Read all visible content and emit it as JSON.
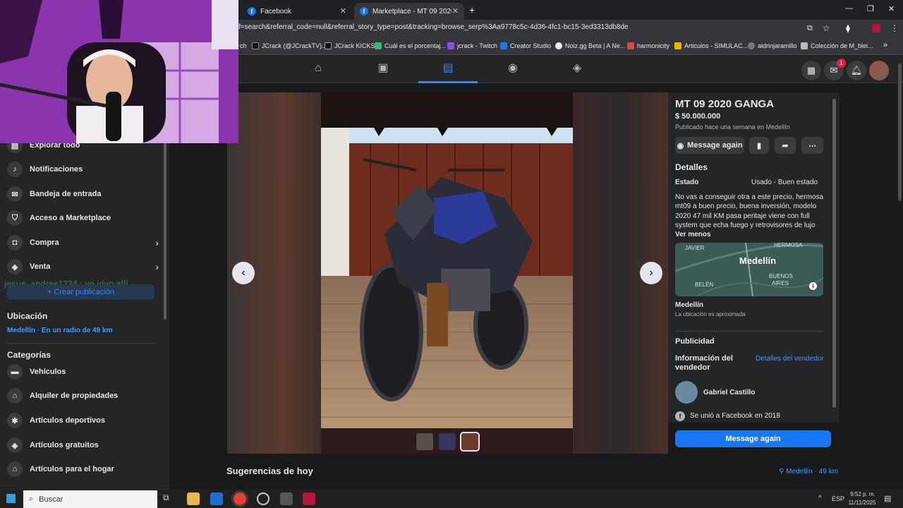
{
  "browser": {
    "tabs": [
      {
        "title": "Facebook",
        "icon": "facebook-icon"
      },
      {
        "title": "Marketplace - MT 09 2020 GAN",
        "icon": "facebook-icon"
      }
    ],
    "new_tab": "+",
    "url": "f=search&referral_code=null&referral_story_type=post&tracking=browse_serp%3Aa9778c5c-4d36-4fc1-bc15-3ed3313db8de",
    "bookmarks": [
      "ch",
      "JCrack (@JCrackTV)...",
      "JCrack KICKS",
      "Cuál es el porcentaj...",
      "jcrack - Twitch",
      "Creator Studio",
      "Noiz.gg Beta | A Ne...",
      "harmonicity",
      "Articulos - SIMULAC...",
      "aldrinjaramillo",
      "Colección de M_blei..."
    ],
    "more": "»"
  },
  "nav": {
    "notification_count": "1"
  },
  "sidebar": {
    "items": [
      {
        "label": "Explorar todo"
      },
      {
        "label": "Notificaciones"
      },
      {
        "label": "Bandeja de entrada"
      },
      {
        "label": "Acceso a Marketplace"
      },
      {
        "label": "Compra"
      },
      {
        "label": "Venta"
      }
    ],
    "create_label": "+ Crear publicación",
    "overlay_text": "jesus_andres1234 : yo vivo allí",
    "location_heading": "Ubicación",
    "location_value": "Medellín · En un radio de 49 km",
    "categories_heading": "Categorías",
    "categories": [
      {
        "label": "Vehículos"
      },
      {
        "label": "Alquiler de propiedades"
      },
      {
        "label": "Artículos deportivos"
      },
      {
        "label": "Artículos gratuitos"
      },
      {
        "label": "Artículos para el hogar"
      }
    ]
  },
  "listing": {
    "title": "MT 09 2020 GANGA",
    "price": "$ 50.000.000",
    "posted": "Publicado hace una semana en Medellín",
    "message_btn": "Message again",
    "details_heading": "Detalles",
    "estado_label": "Estado",
    "estado_value": "Usado - Buen estado",
    "description": "No vas a conseguir otra a este precio, hermosa mt09 a buen precio, buena inversión, modelo 2020 47 mil KM pasa peritaje viene con full system que echa fuego y retrovisores de lujo",
    "see_less": "Ver menos",
    "map_labels": {
      "javier": "JAVIER",
      "hermosa": "HERMOSA",
      "city": "Medellín",
      "buenos": "BUENOS",
      "aires": "AIRES",
      "belen": "BELÉN"
    },
    "location_name": "Medellín",
    "location_note": "La ubicación es aproximada",
    "ads_heading": "Publicidad",
    "seller_heading": "Información del vendedor",
    "seller_details_link": "Detalles del vendedor",
    "seller_name": "Gabriel Castillo",
    "seller_joined": "Se unió a Facebook en 2018",
    "message_bottom": "Message again"
  },
  "suggestions": {
    "heading": "Sugerencias de hoy",
    "location": "Medellín · 49 km"
  },
  "taskbar": {
    "search_placeholder": "Buscar",
    "lang": "ESP",
    "time": "9:52 p. m.",
    "date": "11/11/2025"
  },
  "colors": {
    "accent": "#1877f2",
    "link": "#4599ff",
    "bg": "#18191a",
    "card": "#242526"
  }
}
